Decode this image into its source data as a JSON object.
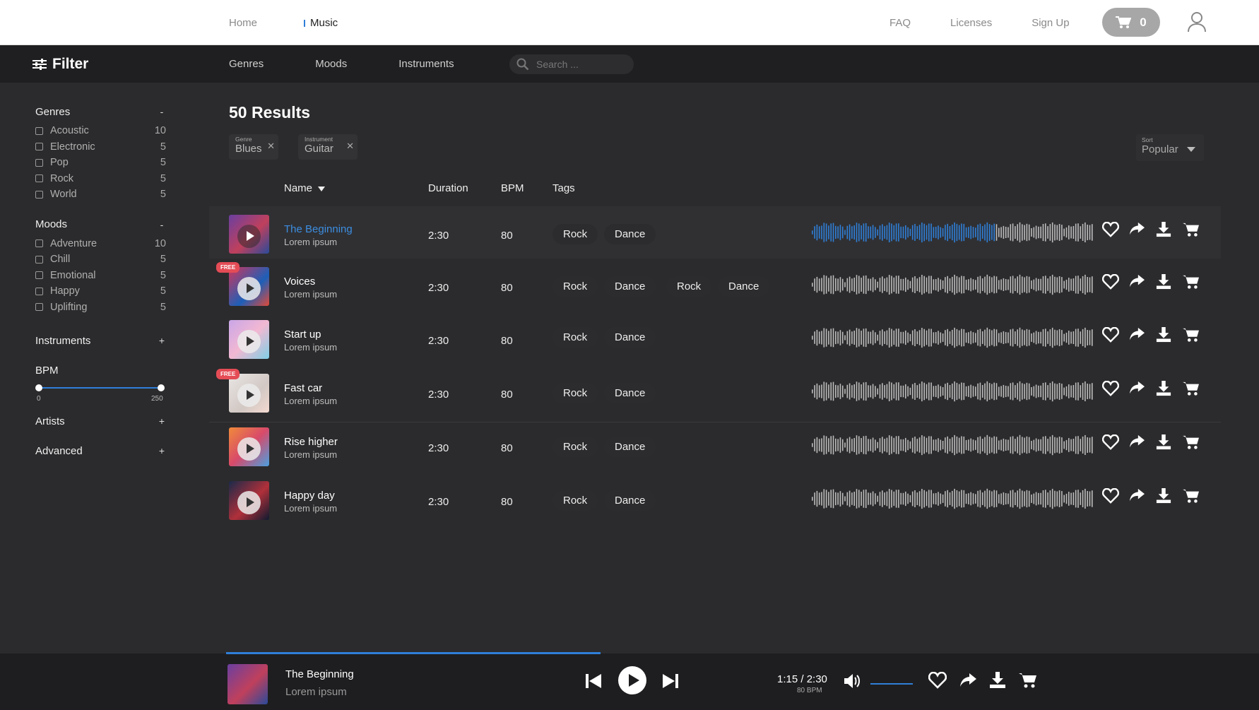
{
  "nav": {
    "home": "Home",
    "music": "Music",
    "faq": "FAQ",
    "licenses": "Licenses",
    "signup": "Sign Up",
    "cart_count": "0"
  },
  "filterbar": {
    "title": "Filter",
    "tabs": [
      "Genres",
      "Moods",
      "Instruments"
    ],
    "search_placeholder": "Search ..."
  },
  "sidebar": {
    "genres": {
      "label": "Genres",
      "toggle": "-",
      "options": [
        {
          "label": "Acoustic",
          "count": "10"
        },
        {
          "label": "Electronic",
          "count": "5"
        },
        {
          "label": "Pop",
          "count": "5"
        },
        {
          "label": "Rock",
          "count": "5"
        },
        {
          "label": "World",
          "count": "5"
        }
      ]
    },
    "moods": {
      "label": "Moods",
      "toggle": "-",
      "options": [
        {
          "label": "Adventure",
          "count": "10"
        },
        {
          "label": "Chill",
          "count": "5"
        },
        {
          "label": "Emotional",
          "count": "5"
        },
        {
          "label": "Happy",
          "count": "5"
        },
        {
          "label": "Uplifting",
          "count": "5"
        }
      ]
    },
    "instruments": {
      "label": "Instruments",
      "toggle": "+"
    },
    "bpm": {
      "label": "BPM",
      "min": "0",
      "max": "250"
    },
    "artists": {
      "label": "Artists",
      "toggle": "+"
    },
    "advanced": {
      "label": "Advanced",
      "toggle": "+"
    }
  },
  "results": {
    "title": "50 Results",
    "chips": [
      {
        "key": "Genre",
        "value": "Blues"
      },
      {
        "key": "Instrument",
        "value": "Guitar"
      }
    ],
    "sort": {
      "key": "Sort",
      "value": "Popular"
    },
    "columns": {
      "name": "Name",
      "duration": "Duration",
      "bpm": "BPM",
      "tags": "Tags"
    }
  },
  "tracks": [
    {
      "title": "The Beginning",
      "sub": "Lorem ipsum",
      "duration": "2:30",
      "bpm": "80",
      "tags": [
        "Rock",
        "Dance"
      ],
      "free": false,
      "active": true
    },
    {
      "title": "Voices",
      "sub": "Lorem ipsum",
      "duration": "2:30",
      "bpm": "80",
      "tags": [
        "Rock",
        "Dance",
        "Rock",
        "Dance"
      ],
      "free": true,
      "free_label": "FREE",
      "active": false
    },
    {
      "title": "Start up",
      "sub": "Lorem ipsum",
      "duration": "2:30",
      "bpm": "80",
      "tags": [
        "Rock",
        "Dance"
      ],
      "free": false,
      "active": false
    },
    {
      "title": "Fast car",
      "sub": "Lorem ipsum",
      "duration": "2:30",
      "bpm": "80",
      "tags": [
        "Rock",
        "Dance"
      ],
      "free": true,
      "free_label": "FREE",
      "active": false
    },
    {
      "title": "Rise higher",
      "sub": "Lorem ipsum",
      "duration": "2:30",
      "bpm": "80",
      "tags": [
        "Rock",
        "Dance"
      ],
      "free": false,
      "active": false
    },
    {
      "title": "Happy day",
      "sub": "Lorem ipsum",
      "duration": "2:30",
      "bpm": "80",
      "tags": [
        "Rock",
        "Dance"
      ],
      "free": false,
      "active": false
    }
  ],
  "player": {
    "title": "The Beginning",
    "sub": "Lorem ipsum",
    "time": "1:15 / 2:30",
    "bpm": "80 BPM",
    "progress": 0.375
  },
  "colors": {
    "accent": "#2f7fd8",
    "free_badge": "#e44c56",
    "background": "#2b2b2d"
  },
  "icons": [
    "filter-icon",
    "search-icon",
    "cart-icon",
    "user-icon",
    "heart-icon",
    "share-icon",
    "download-icon",
    "play-icon",
    "prev-icon",
    "next-icon",
    "volume-icon"
  ]
}
